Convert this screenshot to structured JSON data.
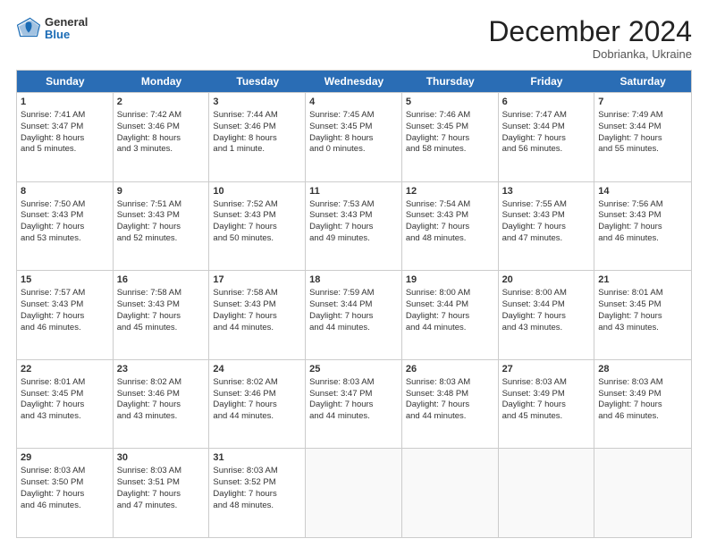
{
  "header": {
    "logo": {
      "general": "General",
      "blue": "Blue"
    },
    "title": "December 2024",
    "location": "Dobrianka, Ukraine"
  },
  "weekdays": [
    "Sunday",
    "Monday",
    "Tuesday",
    "Wednesday",
    "Thursday",
    "Friday",
    "Saturday"
  ],
  "weeks": [
    [
      {
        "day": "1",
        "lines": [
          "Sunrise: 7:41 AM",
          "Sunset: 3:47 PM",
          "Daylight: 8 hours",
          "and 5 minutes."
        ]
      },
      {
        "day": "2",
        "lines": [
          "Sunrise: 7:42 AM",
          "Sunset: 3:46 PM",
          "Daylight: 8 hours",
          "and 3 minutes."
        ]
      },
      {
        "day": "3",
        "lines": [
          "Sunrise: 7:44 AM",
          "Sunset: 3:46 PM",
          "Daylight: 8 hours",
          "and 1 minute."
        ]
      },
      {
        "day": "4",
        "lines": [
          "Sunrise: 7:45 AM",
          "Sunset: 3:45 PM",
          "Daylight: 8 hours",
          "and 0 minutes."
        ]
      },
      {
        "day": "5",
        "lines": [
          "Sunrise: 7:46 AM",
          "Sunset: 3:45 PM",
          "Daylight: 7 hours",
          "and 58 minutes."
        ]
      },
      {
        "day": "6",
        "lines": [
          "Sunrise: 7:47 AM",
          "Sunset: 3:44 PM",
          "Daylight: 7 hours",
          "and 56 minutes."
        ]
      },
      {
        "day": "7",
        "lines": [
          "Sunrise: 7:49 AM",
          "Sunset: 3:44 PM",
          "Daylight: 7 hours",
          "and 55 minutes."
        ]
      }
    ],
    [
      {
        "day": "8",
        "lines": [
          "Sunrise: 7:50 AM",
          "Sunset: 3:43 PM",
          "Daylight: 7 hours",
          "and 53 minutes."
        ]
      },
      {
        "day": "9",
        "lines": [
          "Sunrise: 7:51 AM",
          "Sunset: 3:43 PM",
          "Daylight: 7 hours",
          "and 52 minutes."
        ]
      },
      {
        "day": "10",
        "lines": [
          "Sunrise: 7:52 AM",
          "Sunset: 3:43 PM",
          "Daylight: 7 hours",
          "and 50 minutes."
        ]
      },
      {
        "day": "11",
        "lines": [
          "Sunrise: 7:53 AM",
          "Sunset: 3:43 PM",
          "Daylight: 7 hours",
          "and 49 minutes."
        ]
      },
      {
        "day": "12",
        "lines": [
          "Sunrise: 7:54 AM",
          "Sunset: 3:43 PM",
          "Daylight: 7 hours",
          "and 48 minutes."
        ]
      },
      {
        "day": "13",
        "lines": [
          "Sunrise: 7:55 AM",
          "Sunset: 3:43 PM",
          "Daylight: 7 hours",
          "and 47 minutes."
        ]
      },
      {
        "day": "14",
        "lines": [
          "Sunrise: 7:56 AM",
          "Sunset: 3:43 PM",
          "Daylight: 7 hours",
          "and 46 minutes."
        ]
      }
    ],
    [
      {
        "day": "15",
        "lines": [
          "Sunrise: 7:57 AM",
          "Sunset: 3:43 PM",
          "Daylight: 7 hours",
          "and 46 minutes."
        ]
      },
      {
        "day": "16",
        "lines": [
          "Sunrise: 7:58 AM",
          "Sunset: 3:43 PM",
          "Daylight: 7 hours",
          "and 45 minutes."
        ]
      },
      {
        "day": "17",
        "lines": [
          "Sunrise: 7:58 AM",
          "Sunset: 3:43 PM",
          "Daylight: 7 hours",
          "and 44 minutes."
        ]
      },
      {
        "day": "18",
        "lines": [
          "Sunrise: 7:59 AM",
          "Sunset: 3:44 PM",
          "Daylight: 7 hours",
          "and 44 minutes."
        ]
      },
      {
        "day": "19",
        "lines": [
          "Sunrise: 8:00 AM",
          "Sunset: 3:44 PM",
          "Daylight: 7 hours",
          "and 44 minutes."
        ]
      },
      {
        "day": "20",
        "lines": [
          "Sunrise: 8:00 AM",
          "Sunset: 3:44 PM",
          "Daylight: 7 hours",
          "and 43 minutes."
        ]
      },
      {
        "day": "21",
        "lines": [
          "Sunrise: 8:01 AM",
          "Sunset: 3:45 PM",
          "Daylight: 7 hours",
          "and 43 minutes."
        ]
      }
    ],
    [
      {
        "day": "22",
        "lines": [
          "Sunrise: 8:01 AM",
          "Sunset: 3:45 PM",
          "Daylight: 7 hours",
          "and 43 minutes."
        ]
      },
      {
        "day": "23",
        "lines": [
          "Sunrise: 8:02 AM",
          "Sunset: 3:46 PM",
          "Daylight: 7 hours",
          "and 43 minutes."
        ]
      },
      {
        "day": "24",
        "lines": [
          "Sunrise: 8:02 AM",
          "Sunset: 3:46 PM",
          "Daylight: 7 hours",
          "and 44 minutes."
        ]
      },
      {
        "day": "25",
        "lines": [
          "Sunrise: 8:03 AM",
          "Sunset: 3:47 PM",
          "Daylight: 7 hours",
          "and 44 minutes."
        ]
      },
      {
        "day": "26",
        "lines": [
          "Sunrise: 8:03 AM",
          "Sunset: 3:48 PM",
          "Daylight: 7 hours",
          "and 44 minutes."
        ]
      },
      {
        "day": "27",
        "lines": [
          "Sunrise: 8:03 AM",
          "Sunset: 3:49 PM",
          "Daylight: 7 hours",
          "and 45 minutes."
        ]
      },
      {
        "day": "28",
        "lines": [
          "Sunrise: 8:03 AM",
          "Sunset: 3:49 PM",
          "Daylight: 7 hours",
          "and 46 minutes."
        ]
      }
    ],
    [
      {
        "day": "29",
        "lines": [
          "Sunrise: 8:03 AM",
          "Sunset: 3:50 PM",
          "Daylight: 7 hours",
          "and 46 minutes."
        ]
      },
      {
        "day": "30",
        "lines": [
          "Sunrise: 8:03 AM",
          "Sunset: 3:51 PM",
          "Daylight: 7 hours",
          "and 47 minutes."
        ]
      },
      {
        "day": "31",
        "lines": [
          "Sunrise: 8:03 AM",
          "Sunset: 3:52 PM",
          "Daylight: 7 hours",
          "and 48 minutes."
        ]
      },
      null,
      null,
      null,
      null
    ]
  ]
}
